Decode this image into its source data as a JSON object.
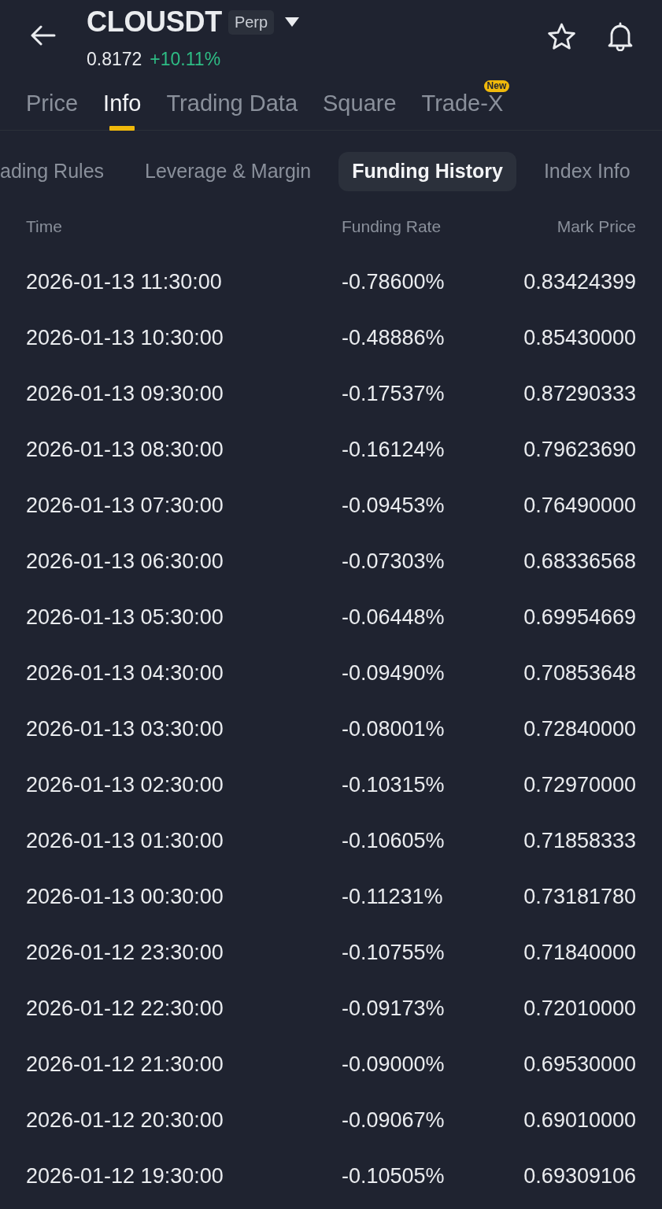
{
  "header": {
    "title": "CLOUSDT",
    "badge": "Perp",
    "price": "0.8172",
    "change": "+10.11%"
  },
  "tabs": [
    {
      "label": "Price",
      "selected": false
    },
    {
      "label": "Info",
      "selected": true
    },
    {
      "label": "Trading Data",
      "selected": false
    },
    {
      "label": "Square",
      "selected": false
    },
    {
      "label": "Trade-X",
      "selected": false,
      "badge": "New"
    }
  ],
  "sub_tabs": [
    {
      "label": "ading Rules",
      "selected": false
    },
    {
      "label": "Leverage & Margin",
      "selected": false
    },
    {
      "label": "Funding History",
      "selected": true
    },
    {
      "label": "Index Info",
      "selected": false
    }
  ],
  "table": {
    "columns": [
      "Time",
      "Funding Rate",
      "Mark Price"
    ],
    "rows": [
      [
        "2026-01-13 11:30:00",
        "-0.78600%",
        "0.83424399"
      ],
      [
        "2026-01-13 10:30:00",
        "-0.48886%",
        "0.85430000"
      ],
      [
        "2026-01-13 09:30:00",
        "-0.17537%",
        "0.87290333"
      ],
      [
        "2026-01-13 08:30:00",
        "-0.16124%",
        "0.79623690"
      ],
      [
        "2026-01-13 07:30:00",
        "-0.09453%",
        "0.76490000"
      ],
      [
        "2026-01-13 06:30:00",
        "-0.07303%",
        "0.68336568"
      ],
      [
        "2026-01-13 05:30:00",
        "-0.06448%",
        "0.69954669"
      ],
      [
        "2026-01-13 04:30:00",
        "-0.09490%",
        "0.70853648"
      ],
      [
        "2026-01-13 03:30:00",
        "-0.08001%",
        "0.72840000"
      ],
      [
        "2026-01-13 02:30:00",
        "-0.10315%",
        "0.72970000"
      ],
      [
        "2026-01-13 01:30:00",
        "-0.10605%",
        "0.71858333"
      ],
      [
        "2026-01-13 00:30:00",
        "-0.11231%",
        "0.73181780"
      ],
      [
        "2026-01-12 23:30:00",
        "-0.10755%",
        "0.71840000"
      ],
      [
        "2026-01-12 22:30:00",
        "-0.09173%",
        "0.72010000"
      ],
      [
        "2026-01-12 21:30:00",
        "-0.09000%",
        "0.69530000"
      ],
      [
        "2026-01-12 20:30:00",
        "-0.09067%",
        "0.69010000"
      ],
      [
        "2026-01-12 19:30:00",
        "-0.10505%",
        "0.69309106"
      ]
    ]
  }
}
